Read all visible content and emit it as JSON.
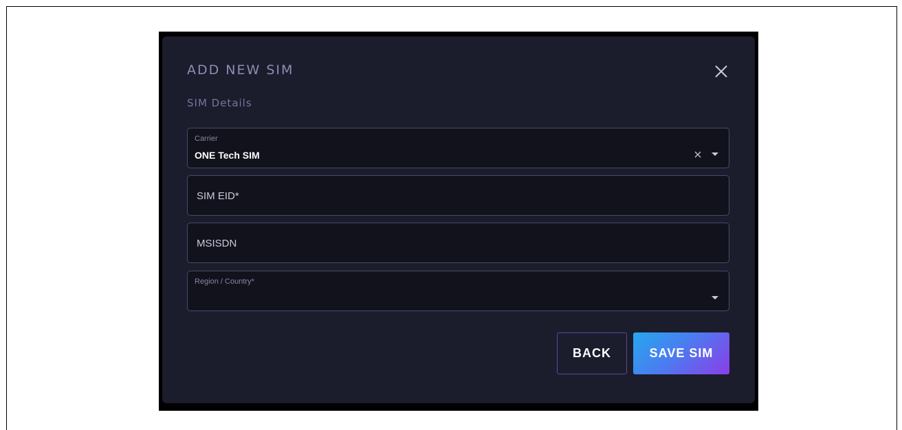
{
  "modal": {
    "title": "ADD NEW SIM",
    "section_label": "SIM Details",
    "close_icon": "close-icon"
  },
  "fields": {
    "carrier": {
      "label": "Carrier",
      "value": "ONE Tech SIM"
    },
    "sim_eid": {
      "placeholder": "SIM EID*"
    },
    "msisdn": {
      "placeholder": "MSISDN"
    },
    "region": {
      "label": "Region / Country*",
      "value": ""
    }
  },
  "buttons": {
    "back": "BACK",
    "save": "SAVE SIM"
  },
  "colors": {
    "modal_background": "#1b1c2c",
    "field_background": "#11121c",
    "accent_gradient_start": "#27a7ee",
    "accent_gradient_end": "#8b3de8"
  }
}
